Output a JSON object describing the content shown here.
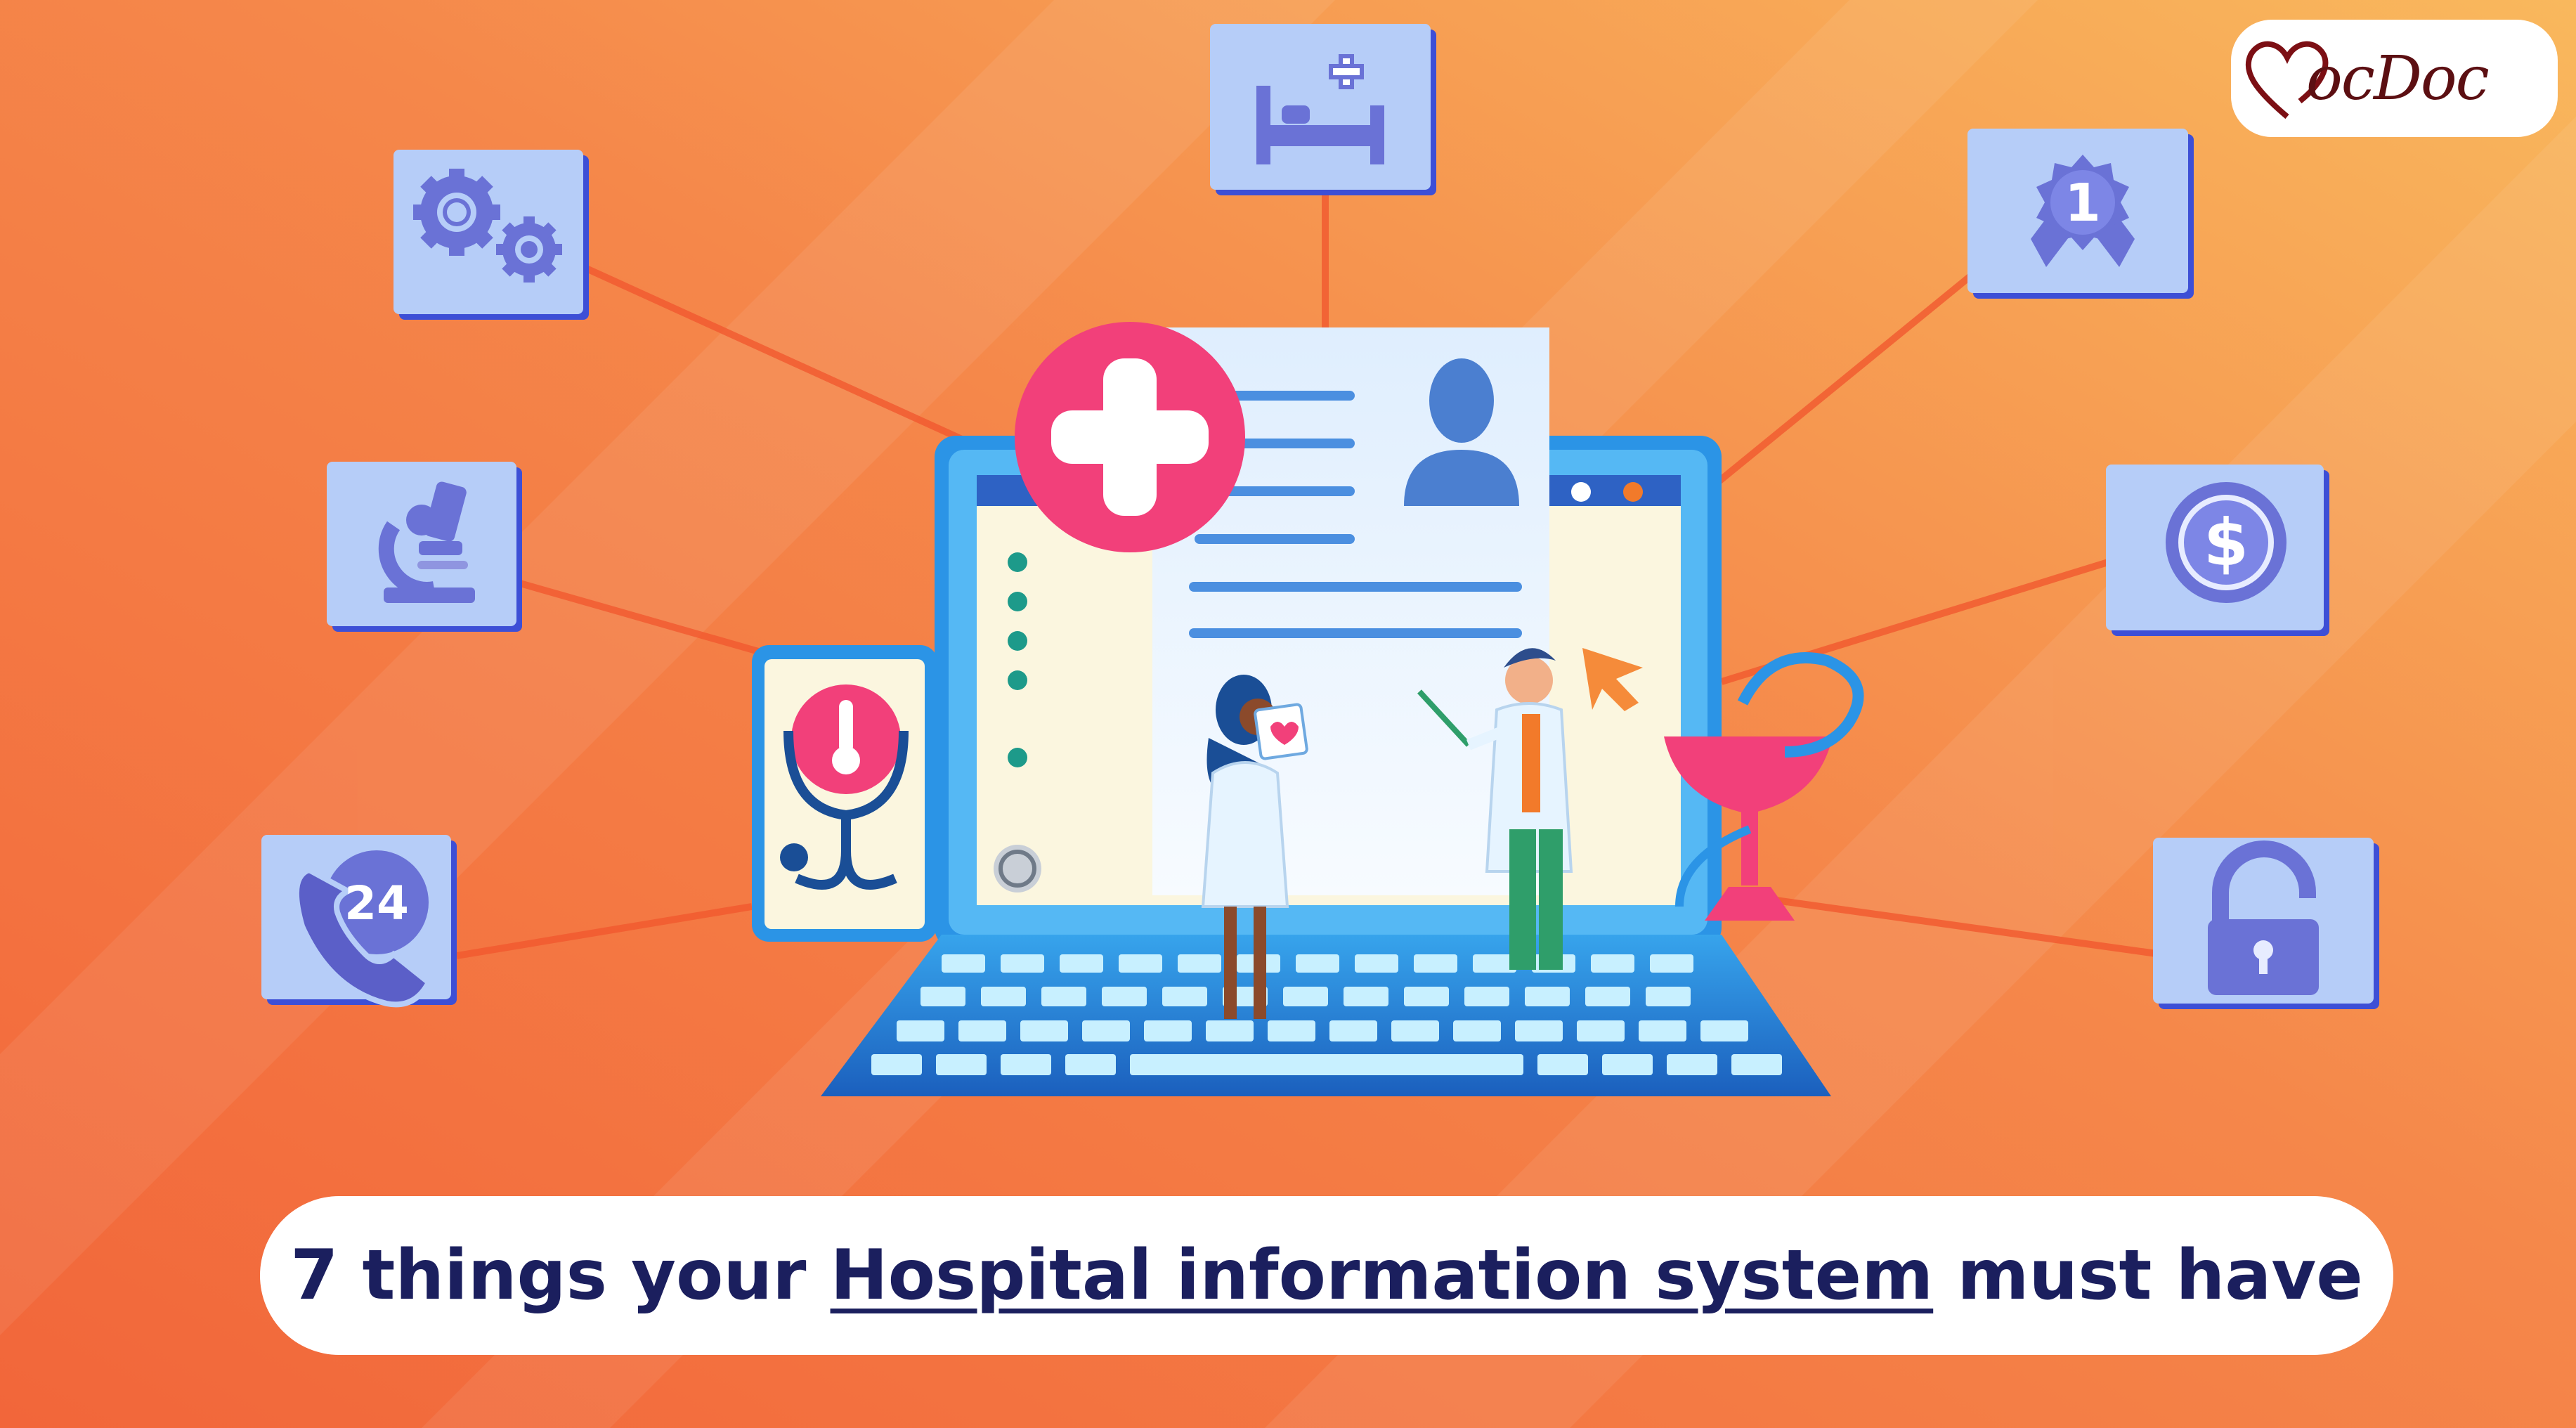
{
  "headline": {
    "prefix": "7 things your ",
    "emphasis": "Hospital information system",
    "suffix": " must have"
  },
  "logo": {
    "brand": "MocDoc",
    "wordmark": "ocDoc"
  },
  "badges": {
    "rank": "1",
    "hours": "24",
    "currency": "$"
  },
  "icons": [
    "settings-icon",
    "microscope-icon",
    "support-24-icon",
    "hospital-bed-icon",
    "award-icon",
    "billing-icon",
    "security-icon"
  ],
  "colors": {
    "background_start": "#f26a3a",
    "background_end": "#f8ad57",
    "tile": "#b6cdf8",
    "tile_border": "#3d4fd6",
    "icon": "#6a72d6",
    "accent_pink": "#f2407a",
    "navy": "#1b1f5e"
  }
}
